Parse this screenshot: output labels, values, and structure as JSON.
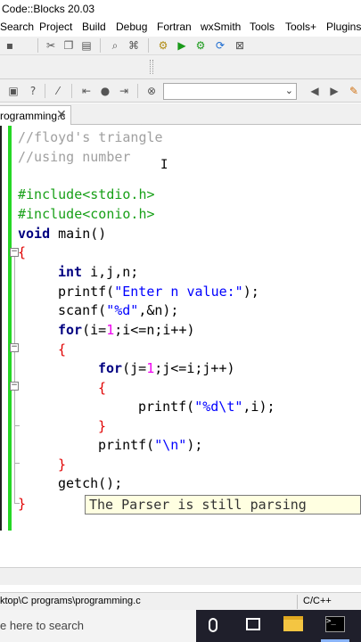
{
  "window": {
    "title": "Code::Blocks 20.03"
  },
  "menu": [
    "Search",
    "Project",
    "Build",
    "Debug",
    "Fortran",
    "wxSmith",
    "Tools",
    "Tools+",
    "Plugins"
  ],
  "toolbar": {
    "icons": [
      "cut-icon",
      "copy-icon",
      "paste-icon",
      "find-icon",
      "replace-icon",
      "settings-icon",
      "run-icon",
      "debug-icon",
      "rebuild-icon",
      "abort-icon"
    ],
    "combo_value": ""
  },
  "tab": {
    "label": "rogramming.c",
    "close": "✕"
  },
  "code": {
    "line1": "//floyd's triangle",
    "line2": "//using number",
    "inc1": "#include<stdio.h>",
    "inc2": "#include<conio.h>",
    "void_kw": "void",
    "main_sig": " main()",
    "open_brace": "{",
    "int_kw": "int",
    "decl": " i,j,n;",
    "printf1_fn": "printf(",
    "printf1_str": "\"Enter n value:\"",
    "printf1_end": ");",
    "scanf_fn": "scanf(",
    "scanf_str": "\"%d\"",
    "scanf_end": ",&n);",
    "for_kw": "for",
    "for1_a": "(i=",
    "one": "1",
    "for1_b": ";i<=n;i++)",
    "brace_open": "{",
    "for2_a": "(j=",
    "for2_b": ";j<=i;j++)",
    "printf2_fn": "printf(",
    "printf2_str": "\"%d\\t\"",
    "printf2_end": ",i);",
    "brace_close": "}",
    "printf3_fn": "printf(",
    "printf3_str": "\"\\n\"",
    "printf3_end": ");",
    "getch": "getch();",
    "close_brace": "}"
  },
  "tooltip": {
    "text": "The Parser is still parsing"
  },
  "status": {
    "path": "ktop\\C programs\\programming.c",
    "language": "C/C++"
  },
  "taskbar": {
    "search_placeholder": "e here to search"
  },
  "colors": {
    "comment": "#a0a0a0",
    "preprocessor": "#18a018",
    "keyword": "#000080",
    "number": "#f000f0",
    "string": "#0000ff",
    "brace": "#e00000",
    "change_bar": "#25d725"
  }
}
